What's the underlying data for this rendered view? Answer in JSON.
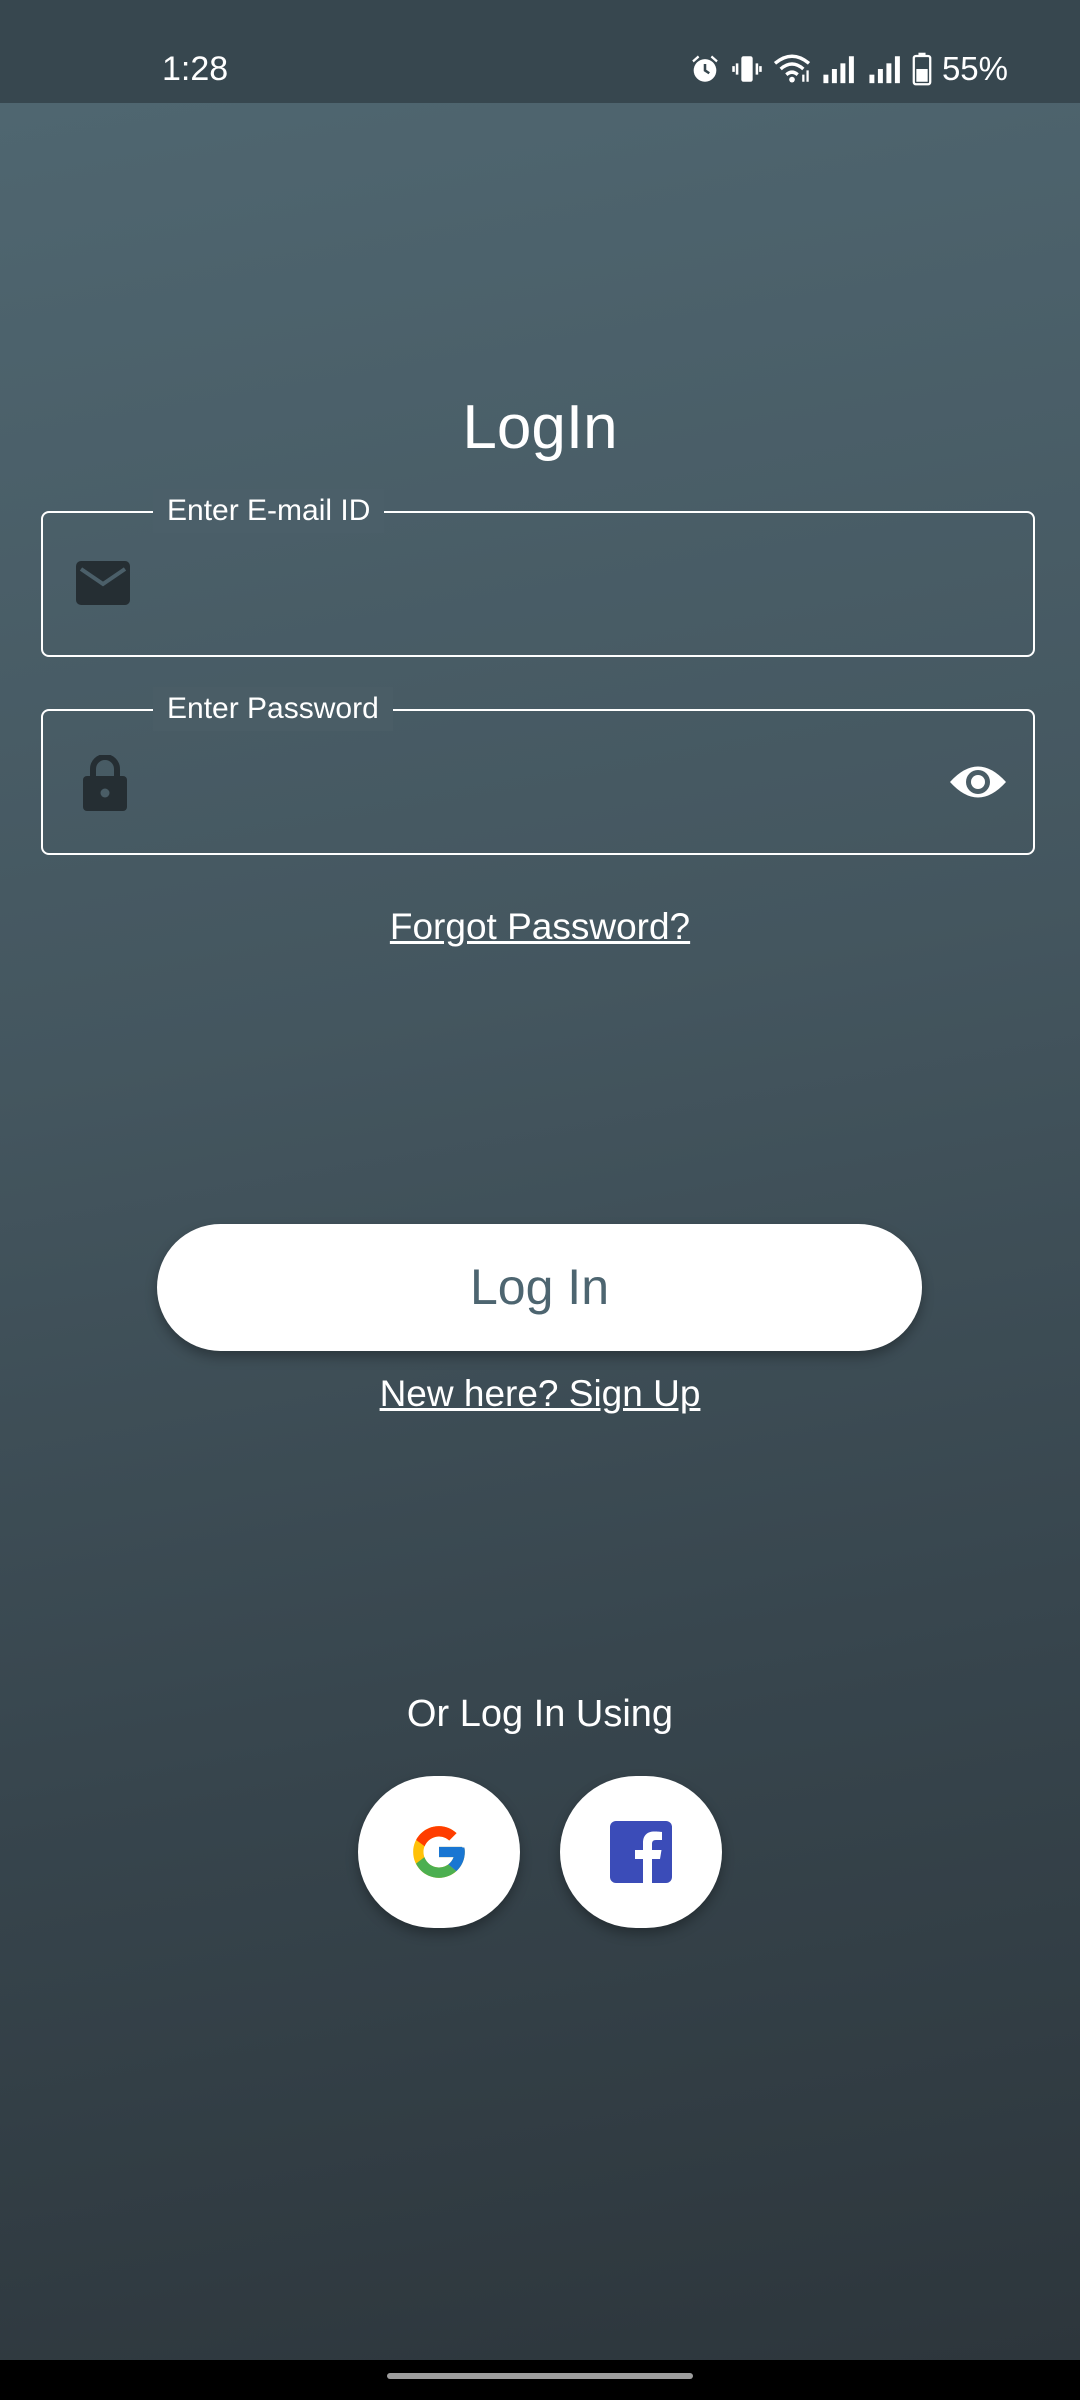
{
  "status_bar": {
    "time": "1:28",
    "battery_percent": "55%",
    "icons": [
      "alarm-icon",
      "vibrate-icon",
      "wifi-icon",
      "signal-icon",
      "signal-icon",
      "battery-icon"
    ]
  },
  "login": {
    "title": "LogIn",
    "email_field": {
      "label": "Enter E-mail ID",
      "value": "",
      "icon": "mail-icon"
    },
    "password_field": {
      "label": "Enter Password",
      "value": "",
      "icon": "lock-icon",
      "toggle_icon": "eye-icon"
    },
    "forgot_password": "Forgot Password?",
    "login_button": "Log In",
    "signup_link": "New here? Sign Up",
    "alt_login_label": "Or Log In Using",
    "social_buttons": [
      {
        "icon": "google-icon"
      },
      {
        "icon": "facebook-icon"
      }
    ]
  },
  "colors": {
    "background_top": "#4f6670",
    "background_bottom": "#2d363c",
    "status_bar": "#37474f",
    "button_text": "#4d6570",
    "facebook_blue": "#3b4cb8",
    "icon_dark": "#252e33"
  }
}
